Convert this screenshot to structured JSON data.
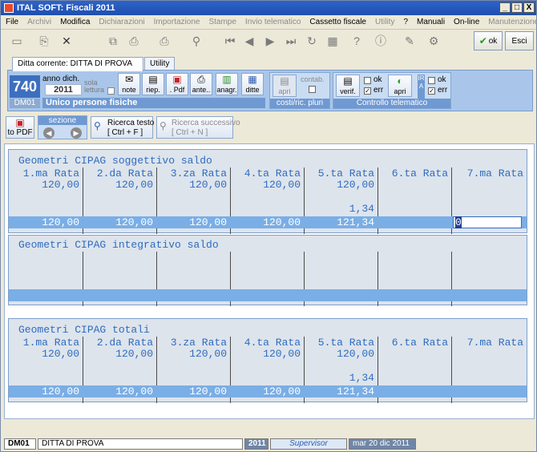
{
  "window": {
    "title": "ITAL SOFT: Fiscali 2011",
    "controls": [
      "_",
      "□",
      "X"
    ]
  },
  "menu": [
    {
      "label": "File",
      "enabled": true
    },
    {
      "label": "Archivi",
      "enabled": false
    },
    {
      "label": "Modifica",
      "enabled": true
    },
    {
      "label": "Dichiarazioni",
      "enabled": false
    },
    {
      "label": "Importazione",
      "enabled": false
    },
    {
      "label": "Stampe",
      "enabled": false
    },
    {
      "label": "Invio telematico",
      "enabled": false
    },
    {
      "label": "Cassetto fiscale",
      "enabled": true
    },
    {
      "label": "Utility",
      "enabled": false
    },
    {
      "label": "?",
      "enabled": true
    },
    {
      "label": "Manuali",
      "enabled": true
    },
    {
      "label": "On-line",
      "enabled": true
    },
    {
      "label": "Manutenzione",
      "enabled": false
    }
  ],
  "toolbar": {
    "ok_label": "ok",
    "esc_label": "Esci",
    "icons": [
      "new-doc-icon",
      "open-icon",
      "delete-icon",
      "copy-icon",
      "print-icon",
      "printer-setup-icon",
      "search-icon",
      "first-icon",
      "prev-icon",
      "next-icon",
      "last-icon",
      "refresh-icon",
      "card-icon",
      "help-icon",
      "info-icon",
      "edit-icon",
      "tools-icon"
    ]
  },
  "tabs": [
    {
      "label": "Ditta corrente: DITTA DI PROVA",
      "active": true
    },
    {
      "label": "Utility",
      "active": false
    }
  ],
  "ribbon": {
    "model_code": "740",
    "model_sub": "DM01",
    "anno_label": "anno dich.",
    "anno_value": "2011",
    "sola_lettura_1": "sola",
    "sola_lettura_2": "lettura",
    "model_name": "Unico persone fisiche",
    "buttons": [
      {
        "label": "note",
        "icon": "note-icon"
      },
      {
        "label": "riep.",
        "icon": "summary-icon"
      },
      {
        "label": ". Pdf",
        "icon": "pdf-icon"
      },
      {
        "label": "ante..",
        "icon": "preview-icon"
      },
      {
        "label": "anagr.",
        "icon": "registry-icon"
      },
      {
        "label": "ditte",
        "icon": "companies-icon"
      }
    ],
    "costi": {
      "apri_label": "apri",
      "contab_label": "contab.",
      "group_label": "costi/ric. pluri"
    },
    "telematico": {
      "verif_label": "verif.",
      "ok_label": "ok",
      "err_label": "err",
      "apri_label": "apri",
      "ira_label": "IRA",
      "ok2_label": "ok",
      "err2_label": "err",
      "group_label": "Controllo telematico"
    }
  },
  "row2": {
    "topdf_label": "to PDF",
    "sezione_label": "sezione",
    "ricerca_label": "Ricerca testo",
    "ricerca_short": "[ Ctrl + F ]",
    "ricerca_succ_label": "Ricerca successivo",
    "ricerca_succ_short": "[ Ctrl + N ]"
  },
  "columns": [
    "1.ma Rata",
    "2.da Rata",
    "3.za Rata",
    "4.ta Rata",
    "5.ta Rata",
    "6.ta Rata",
    "7.ma Rata"
  ],
  "sections": [
    {
      "title": "Geometri CIPAG soggettivo saldo",
      "row1": [
        "120,00",
        "120,00",
        "120,00",
        "120,00",
        "120,00",
        "",
        ""
      ],
      "row2": [
        "",
        "",
        "",
        "",
        "1,34",
        "",
        ""
      ],
      "totals": [
        "120,00",
        "120,00",
        "120,00",
        "120,00",
        "121,34",
        "",
        ""
      ],
      "input_value": "0"
    },
    {
      "title": "Geometri CIPAG integrativo saldo"
    },
    {
      "title": "Geometri CIPAG totali",
      "row1": [
        "120,00",
        "120,00",
        "120,00",
        "120,00",
        "120,00",
        "",
        ""
      ],
      "row2": [
        "",
        "",
        "",
        "",
        "1,34",
        "",
        ""
      ],
      "totals": [
        "120,00",
        "120,00",
        "120,00",
        "120,00",
        "121,34",
        "",
        ""
      ]
    }
  ],
  "status": {
    "code": "DM01",
    "company": "DITTA DI PROVA",
    "year": "2011",
    "user": "Supervisor",
    "date": "mar 20 dic 2011"
  }
}
